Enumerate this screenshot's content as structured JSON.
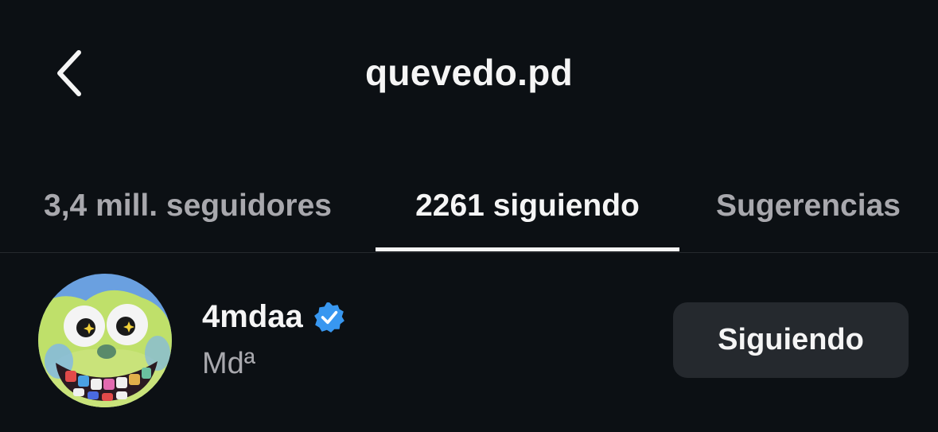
{
  "header": {
    "title": "quevedo.pd",
    "back_icon": "chevron-left-icon"
  },
  "tabs": [
    {
      "label": "3,4 mill. seguidores",
      "active": false
    },
    {
      "label": "2261 siguiendo",
      "active": true
    },
    {
      "label": "Sugerencias",
      "active": false
    }
  ],
  "list": {
    "items": [
      {
        "username": "4mdaa",
        "verified": true,
        "subtitle": "Mdª",
        "button_label": "Siguiendo",
        "avatar_icon": "cartoon-face-avatar"
      }
    ]
  },
  "colors": {
    "background": "#0c1014",
    "text_primary": "#f5f5f5",
    "text_secondary": "#a8a8ad",
    "button_bg": "#25292e",
    "verified_blue": "#3897f0"
  }
}
